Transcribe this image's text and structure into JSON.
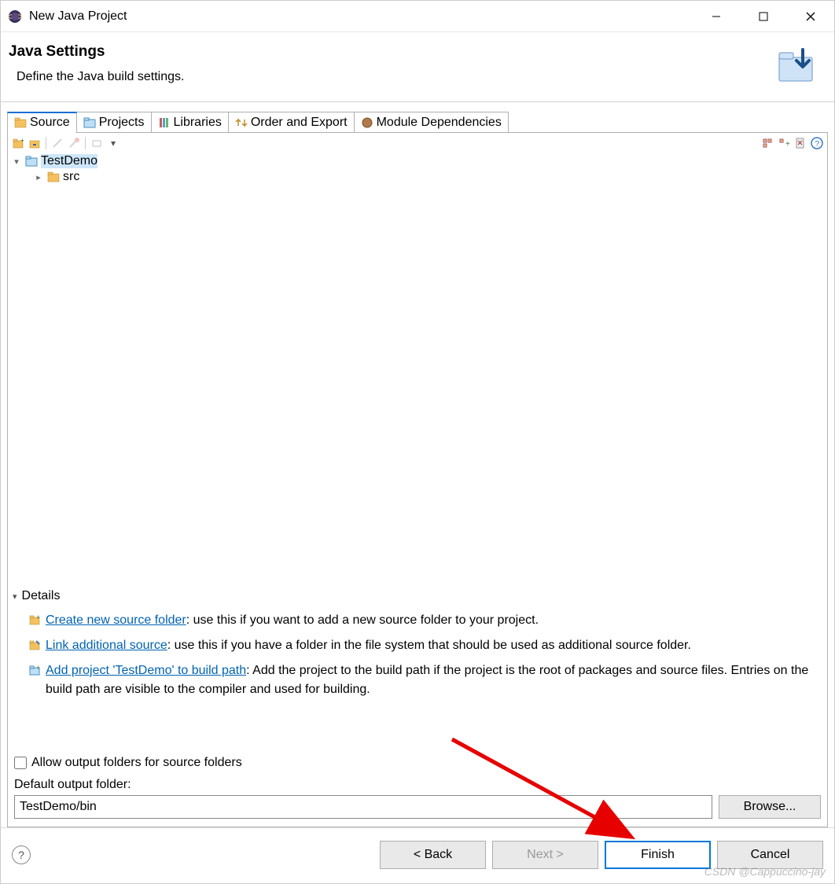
{
  "window": {
    "title": "New Java Project"
  },
  "header": {
    "title": "Java Settings",
    "description": "Define the Java build settings."
  },
  "tabs": [
    {
      "label": "Source",
      "active": true
    },
    {
      "label": "Projects",
      "active": false
    },
    {
      "label": "Libraries",
      "active": false
    },
    {
      "label": "Order and Export",
      "active": false
    },
    {
      "label": "Module Dependencies",
      "active": false
    }
  ],
  "tree": {
    "root": {
      "label": "TestDemo",
      "expanded": true,
      "selected": true
    },
    "children": [
      {
        "label": "src",
        "expandedMarker": ">"
      }
    ]
  },
  "details": {
    "heading": "Details",
    "items": [
      {
        "link": "Create new source folder",
        "rest": ": use this if you want to add a new source folder to your project."
      },
      {
        "link": "Link additional source",
        "rest": ": use this if you have a folder in the file system that should be used as additional source folder."
      },
      {
        "link": "Add project 'TestDemo' to build path",
        "rest": ": Add the project to the build path if the project is the root of packages and source files. Entries on the build path are visible to the compiler and used for building."
      }
    ]
  },
  "options": {
    "allowOutputCheckbox": "Allow output folders for source folders",
    "defaultOutputLabel": "Default output folder:",
    "defaultOutputValue": "TestDemo/bin",
    "browseLabel": "Browse..."
  },
  "buttons": {
    "back": "< Back",
    "next": "Next >",
    "finish": "Finish",
    "cancel": "Cancel"
  },
  "watermark": "CSDN @Cappuccino-jay"
}
